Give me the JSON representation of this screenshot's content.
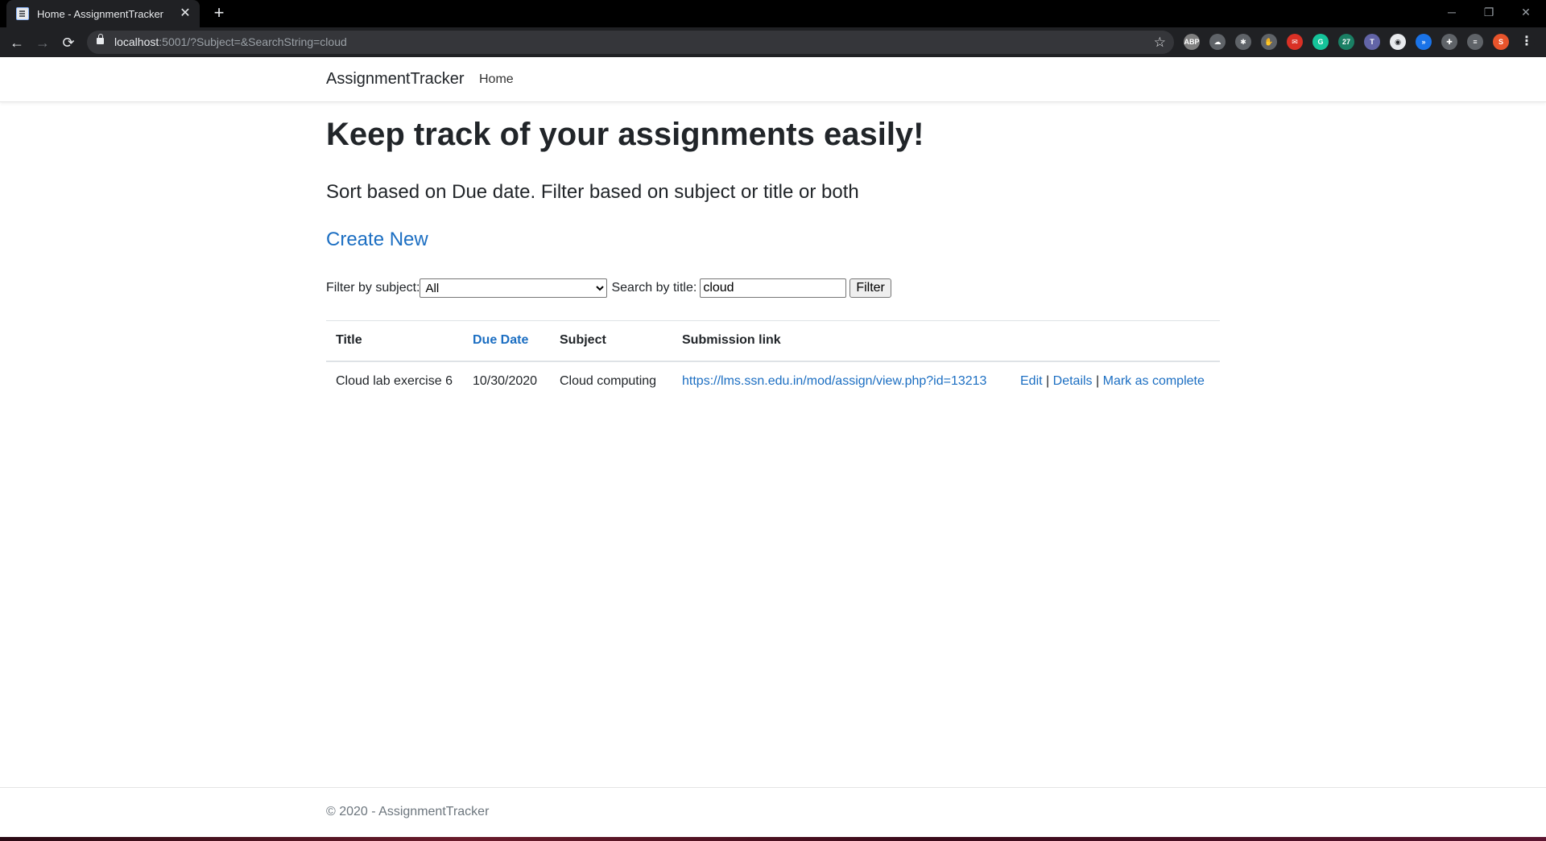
{
  "browser": {
    "tab_title": "Home - AssignmentTracker",
    "close_glyph": "✕",
    "newtab_glyph": "+",
    "url_host": "localhost",
    "url_rest": ":5001/?Subject=&SearchString=cloud",
    "window_controls": {
      "minimize": "─",
      "restore": "❐",
      "close": "✕"
    },
    "nav": {
      "back": "←",
      "forward": "→",
      "reload": "⟳"
    },
    "star": "☆",
    "extensions": [
      {
        "name": "abp-extension-icon",
        "label": "ABP",
        "color": "#7f7f7f"
      },
      {
        "name": "cloud-extension-icon",
        "label": "☁",
        "color": "#5f6368"
      },
      {
        "name": "gear-extension-icon",
        "label": "✱",
        "color": "#5f6368"
      },
      {
        "name": "hand-extension-icon",
        "label": "✋",
        "color": "#5f6368"
      },
      {
        "name": "mail-extension-icon",
        "label": "✉",
        "color": "#d93025"
      },
      {
        "name": "grammarly-extension-icon",
        "label": "G",
        "color": "#15c39a"
      },
      {
        "name": "calendar-extension-icon",
        "label": "27",
        "color": "#1a7f64"
      },
      {
        "name": "teams-extension-icon",
        "label": "T",
        "color": "#6264a7"
      },
      {
        "name": "owl-extension-icon",
        "label": "◉",
        "color": "#e8eaed"
      },
      {
        "name": "wave-extension-icon",
        "label": "»",
        "color": "#1a73e8"
      },
      {
        "name": "puzzle-extension-icon",
        "label": "✚",
        "color": "#5f6368"
      },
      {
        "name": "playlist-extension-icon",
        "label": "≡",
        "color": "#5f6368"
      },
      {
        "name": "profile-avatar-icon",
        "label": "S",
        "color": "#e8542b"
      },
      {
        "name": "menu-kebab-icon",
        "label": "⋮",
        "color": "#202124"
      }
    ]
  },
  "navbar": {
    "brand": "AssignmentTracker",
    "home": "Home"
  },
  "main": {
    "heading": "Keep track of your assignments easily!",
    "subheading": "Sort based on Due date. Filter based on subject or title or both",
    "create_link": "Create New",
    "filter": {
      "subject_label": "Filter by subject:",
      "subject_selected": "All",
      "title_label": "Search by title:",
      "title_value": "cloud",
      "button": "Filter"
    },
    "table": {
      "headers": {
        "title": "Title",
        "due_date": "Due Date",
        "subject": "Subject",
        "link": "Submission link"
      },
      "rows": [
        {
          "title": "Cloud lab exercise 6",
          "due_date": "10/30/2020",
          "subject": "Cloud computing",
          "link": "https://lms.ssn.edu.in/mod/assign/view.php?id=13213",
          "edit": "Edit",
          "details": "Details",
          "complete": "Mark as complete",
          "separator": "|"
        }
      ]
    }
  },
  "footer": {
    "text": "© 2020 - AssignmentTracker"
  }
}
